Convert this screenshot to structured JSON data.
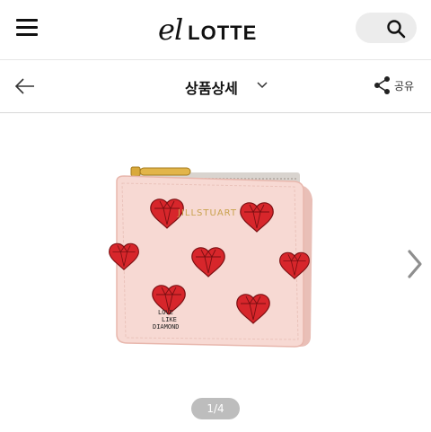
{
  "header": {
    "logo_prefix": "el",
    "logo_brand": "LOTTE"
  },
  "subheader": {
    "title": "상품상세",
    "share_label": "공유"
  },
  "product": {
    "brand_text": "JILLSTUART",
    "tag_lines": [
      "LOVE",
      "LIKE",
      "DIAMOND"
    ]
  },
  "pager": {
    "text": "1/4"
  },
  "colors": {
    "wallet_pink": "#f7d9d3",
    "heart_red": "#d7262b",
    "gold": "#d9a93a"
  }
}
